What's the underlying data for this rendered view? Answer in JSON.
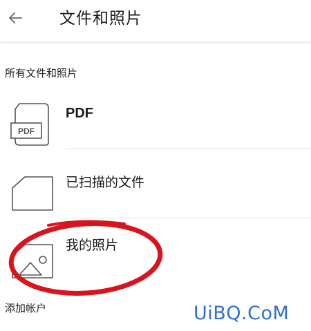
{
  "header": {
    "title": "文件和照片",
    "back_icon": "arrow-left-icon"
  },
  "section": {
    "title": "所有文件和照片"
  },
  "items": [
    {
      "label": "PDF",
      "icon": "pdf-file-icon"
    },
    {
      "label": "已扫描的文件",
      "icon": "folder-icon"
    },
    {
      "label": "我的照片",
      "icon": "image-icon"
    }
  ],
  "add_account": {
    "label": "添加帐户"
  },
  "annotation": {
    "color": "#d8141e"
  },
  "watermark": {
    "text": "UiBQ.CoM",
    "color": "#2f6fd6"
  },
  "pdf_icon_text": "PDF"
}
